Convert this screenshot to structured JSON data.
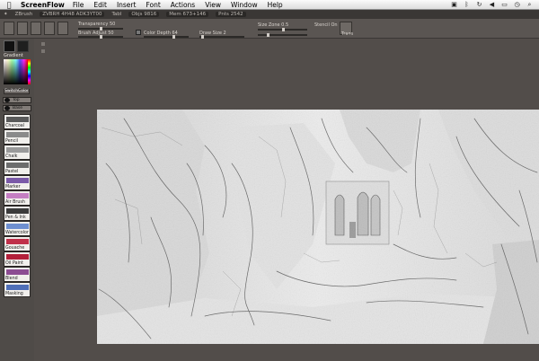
{
  "menubar": {
    "app_name": "ScreenFlow",
    "items": [
      "File",
      "Edit",
      "Insert",
      "Font",
      "Actions",
      "View",
      "Window",
      "Help"
    ]
  },
  "titlestrip": {
    "app": "ZBrush",
    "doc_status": "ZVBRH 4H48 ADK3YT00",
    "tool": "Tabl",
    "objs": "Objs 9816",
    "mem": "Mem 673+146",
    "points": "Pnts 2542"
  },
  "toolbar": {
    "transparency_label": "Transparency 50",
    "brush_adjust_label": "Brush Adjust 50",
    "color_depth_label": "Color Depth 64",
    "draw_size_label": "Draw Size 2",
    "size_zone_label": "Size Zone 0.5",
    "stencil_label": "Stencil On",
    "trans_label": "Trans"
  },
  "palette": {
    "gradient_label": "Gradient",
    "switch_color_label": "SwitchColor",
    "layer_top": "Top",
    "layer_base": "Base",
    "tools": [
      {
        "name": "Charcoal",
        "color": "#5a5a5a"
      },
      {
        "name": "Pencil",
        "color": "#8a8a8a"
      },
      {
        "name": "Chalk",
        "color": "#9a9a9a"
      },
      {
        "name": "Pastel",
        "color": "#6c6c6c"
      },
      {
        "name": "Marker",
        "color": "#7b5aa8"
      },
      {
        "name": "Air Brush",
        "color": "#c47ec2"
      },
      {
        "name": "Pen & Ink",
        "color": "#3b3b3b"
      },
      {
        "name": "Watercolor",
        "color": "#6e8fd0"
      },
      {
        "name": "Gouache",
        "color": "#c0304a"
      },
      {
        "name": "Oil Paint",
        "color": "#b3203a"
      },
      {
        "name": "Blend",
        "color": "#8c4c92"
      },
      {
        "name": "Masking",
        "color": "#4f6fb8"
      }
    ]
  },
  "colors": {
    "foreground": "#111111",
    "background": "#1f1f1f",
    "paper": "#e9e9e9"
  }
}
